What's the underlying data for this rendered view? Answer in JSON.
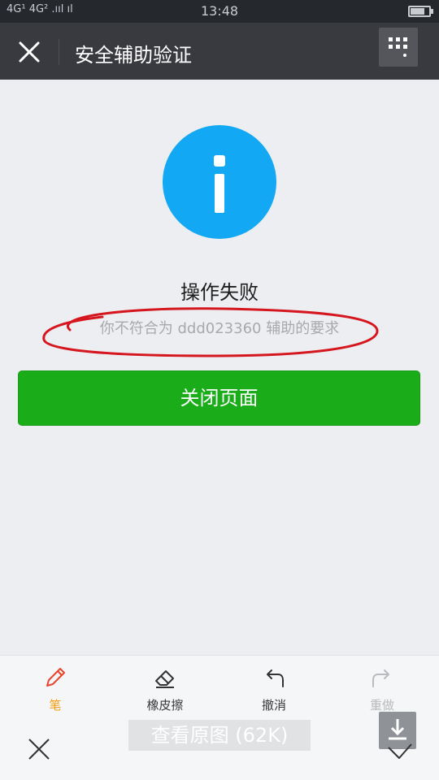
{
  "status_bar": {
    "signal": "4G¹ 4G² .ııl ıl",
    "time": "13:48"
  },
  "nav": {
    "title": "安全辅助验证"
  },
  "result": {
    "heading": "操作失败",
    "message": "你不符合为 ddd023360 辅助的要求",
    "close_button": "关闭页面"
  },
  "editor_toolbar": {
    "pen": "笔",
    "eraser": "橡皮擦",
    "undo": "撤消",
    "redo": "重做"
  },
  "viewer": {
    "view_original": "查看原图 (62K)"
  },
  "colors": {
    "nav_bg": "#393a3f",
    "info_blue": "#12a8f3",
    "primary_green": "#1aad19",
    "annotation_red": "#d6161e",
    "pen_active": "#f39c12"
  },
  "icons": [
    "close-icon",
    "grid-menu-icon",
    "info-icon",
    "pen-icon",
    "eraser-icon",
    "undo-icon",
    "redo-icon",
    "download-icon",
    "check-icon"
  ]
}
